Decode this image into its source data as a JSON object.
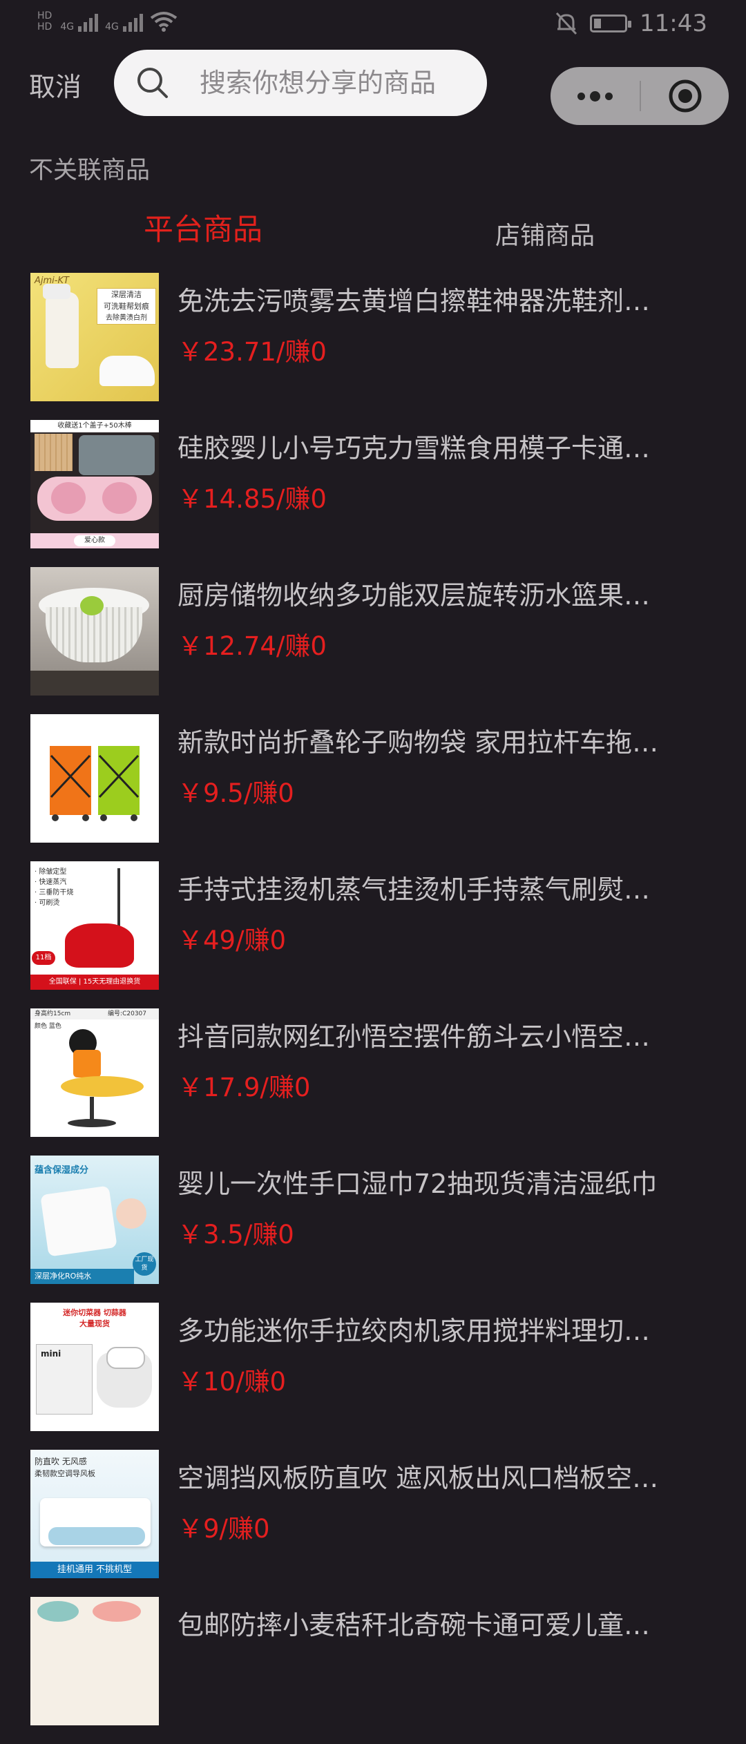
{
  "status_bar": {
    "time": "11:43",
    "sim1_label": "4G",
    "sim2_label": "4G",
    "hd1": "HD",
    "hd2": "HD"
  },
  "header": {
    "cancel_label": "取消",
    "search_placeholder": "搜索你想分享的商品"
  },
  "no_link_label": "不关联商品",
  "tabs": [
    {
      "label": "平台商品",
      "active": true
    },
    {
      "label": "店铺商品",
      "active": false
    }
  ],
  "colors": {
    "accent": "#e2211c",
    "price": "#e51f1f",
    "background": "#1e1a20"
  },
  "products": [
    {
      "title": "免洗去污喷雾去黄增白擦鞋神器洗鞋剂…",
      "price": "￥23.71/赚0",
      "image": "shoe-cleaner-spray"
    },
    {
      "title": "硅胶婴儿小号巧克力雪糕食用模子卡通…",
      "price": "￥14.85/赚0",
      "image": "ice-cream-mold"
    },
    {
      "title": "厨房储物收纳多功能双层旋转沥水篮果…",
      "price": "￥12.74/赚0",
      "image": "drain-basket"
    },
    {
      "title": "新款时尚折叠轮子购物袋 家用拉杆车拖…",
      "price": "￥9.5/赚0",
      "image": "shopping-trolley-bags"
    },
    {
      "title": "手持式挂烫机蒸气挂烫机手持蒸气刷熨…",
      "price": "￥49/赚0",
      "image": "garment-steamer"
    },
    {
      "title": "抖音同款网红孙悟空摆件筋斗云小悟空…",
      "price": "￥17.9/赚0",
      "image": "goku-figure"
    },
    {
      "title": "婴儿一次性手口湿巾72抽现货清洁湿纸巾",
      "price": "￥3.5/赚0",
      "image": "baby-wipes"
    },
    {
      "title": "多功能迷你手拉绞肉机家用搅拌料理切…",
      "price": "￥10/赚0",
      "image": "mini-chopper"
    },
    {
      "title": "空调挡风板防直吹 遮风板出风口档板空…",
      "price": "￥9/赚0",
      "image": "ac-wind-deflector"
    },
    {
      "title": "包邮防摔小麦秸秆北奇碗卡通可爱儿童…",
      "price": "",
      "image": "wheat-straw-bowl"
    }
  ],
  "thumb_text": {
    "shoe_brand": "Ajmi-KT",
    "shoe_1": "深层清洁",
    "shoe_2": "可洗鞋帮划痕",
    "shoe_3": "去除黄渍白剂",
    "mold_top": "收藏送1个盖子+50木棒",
    "mold_bottom": "爱心款",
    "steamer_1": "· 除皱定型",
    "steamer_2": "· 快速蒸汽",
    "steamer_3": "· 三垂防干烧",
    "steamer_4": "· 可刷烫",
    "steamer_badge": "11档",
    "steamer_bottom": "全国联保 | 15天无理由退换货",
    "goku_size": "身高约15cm",
    "goku_color": "颜色 蓝色",
    "goku_code": "编号:C20307",
    "wipes_top": "蕴含保湿成分",
    "wipes_bottom": "深层净化RO纯水",
    "wipes_badge": "工厂现货",
    "chopper_top": "迷你切菜器 切蒜器",
    "chopper_sub": "大量现货",
    "chopper_box": "mini",
    "ac_top": "防直吹 无风感",
    "ac_sub": "柔韧款空调导风板",
    "ac_bottom": "挂机通用 不挑机型"
  }
}
